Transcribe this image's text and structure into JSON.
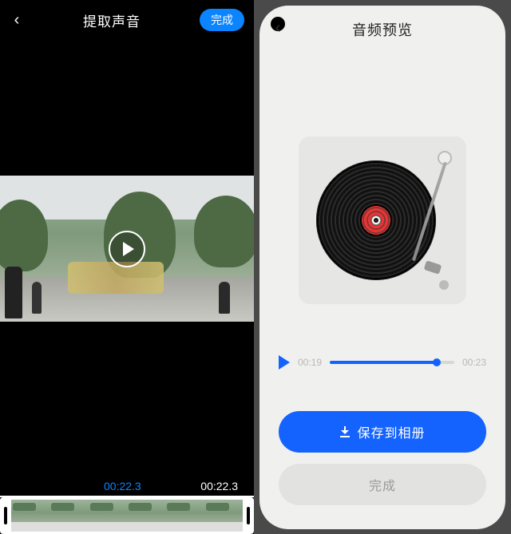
{
  "left": {
    "title": "提取声音",
    "done_label": "完成",
    "current_time": "00:22.3",
    "total_time": "00:22.3"
  },
  "right": {
    "title": "音频预览",
    "elapsed": "00:19",
    "total": "00:23",
    "save_label": "保存到相册",
    "done_label": "完成"
  }
}
